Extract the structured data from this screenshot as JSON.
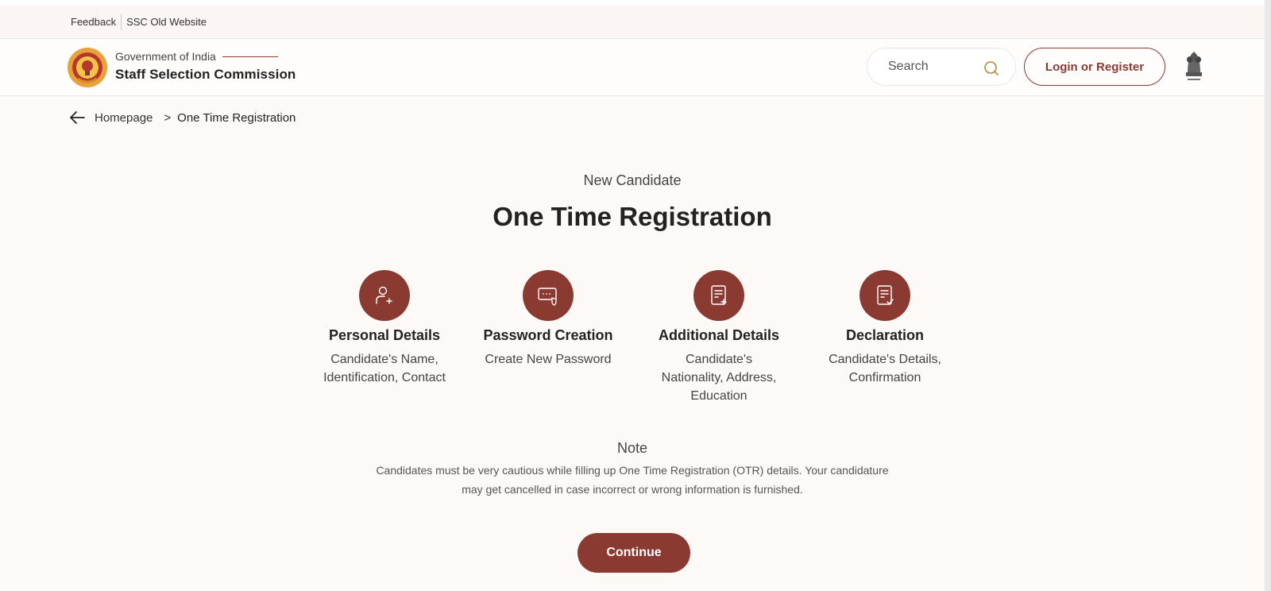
{
  "topbar": {
    "feedback": "Feedback",
    "old_website": "SSC Old Website"
  },
  "header": {
    "gov_label": "Government of India",
    "org_name": "Staff Selection Commission",
    "search_placeholder": "Search",
    "login_label": "Login or Register"
  },
  "breadcrumb": {
    "home": "Homepage",
    "separator": ">",
    "current": "One Time Registration"
  },
  "main": {
    "eyebrow": "New Candidate",
    "title": "One Time Registration",
    "steps": [
      {
        "icon": "user-add-icon",
        "title": "Personal Details",
        "desc_lines": [
          "Candidate's Name,",
          "Identification, Contact"
        ]
      },
      {
        "icon": "password-lock-icon",
        "title": "Password Creation",
        "desc_lines": [
          "Create New Password"
        ]
      },
      {
        "icon": "document-add-icon",
        "title": "Additional Details",
        "desc_lines": [
          "Candidate's",
          "Nationality, Address,",
          "Education"
        ]
      },
      {
        "icon": "document-check-icon",
        "title": "Declaration",
        "desc_lines": [
          "Candidate's Details,",
          "Confirmation"
        ]
      }
    ],
    "note_title": "Note",
    "note_lines": [
      "Candidates must be very cautious while filling up One Time Registration (OTR) details. Your candidature",
      "may get cancelled in case incorrect or wrong information is furnished."
    ],
    "continue_label": "Continue"
  },
  "colors": {
    "accent": "#8b3a32",
    "background": "#fdf9f7"
  }
}
